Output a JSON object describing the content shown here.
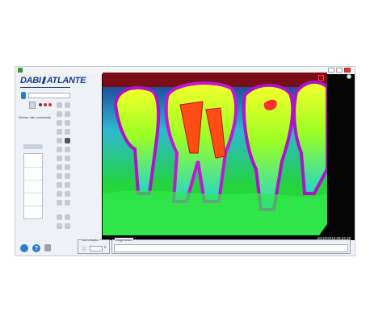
{
  "app": {
    "brand": "DABI ATLANTE",
    "brand_part1": "DABI",
    "brand_part2": "ATLANTE"
  },
  "sidebar": {
    "sensor_status": "Sensor não conectado",
    "sensor_select": "",
    "thumbnails": [
      "",
      "",
      "",
      "",
      ""
    ]
  },
  "viewer": {
    "timestamp": "26/10/2018 09:24:15"
  },
  "footer": {
    "numeracao_label": "Numeração",
    "numeracao_value": "",
    "diagnostico_label": "Diagnóstico",
    "diagnostico_value": ""
  },
  "colors": {
    "brand": "#1a3c8c",
    "accent_blue": "#2f7bd0",
    "record_red": "#d62a2a"
  },
  "icons": {
    "help": "?",
    "close": "x"
  }
}
